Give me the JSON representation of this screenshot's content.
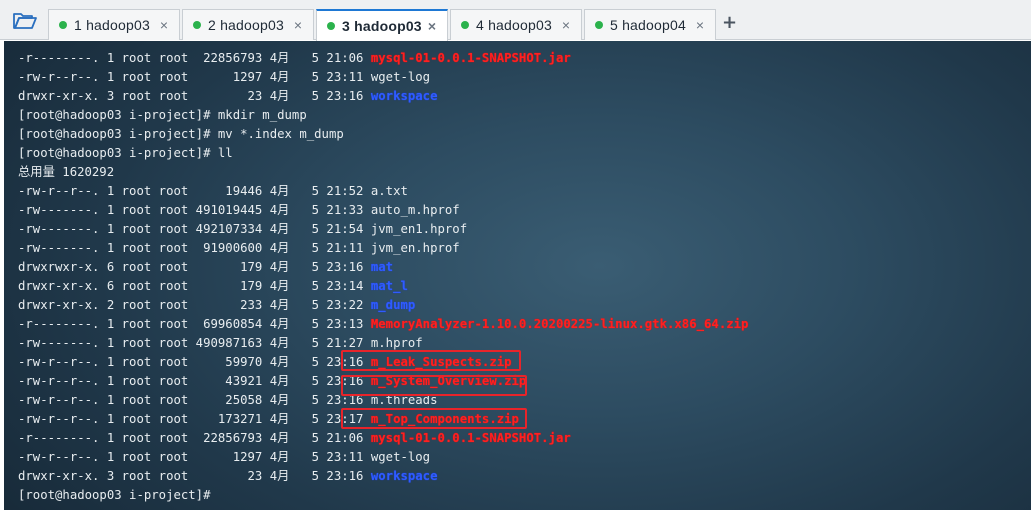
{
  "tabs": [
    {
      "label": "1 hadoop03",
      "active": false
    },
    {
      "label": "2 hadoop03",
      "active": false
    },
    {
      "label": "3 hadoop03",
      "active": true
    },
    {
      "label": "4 hadoop03",
      "active": false
    },
    {
      "label": "5 hadoop04",
      "active": false
    }
  ],
  "tab_close_glyph": "×",
  "new_tab_glyph": "+",
  "colors": {
    "tab_status_dot": "#2bb24c",
    "active_tab_accent": "#1e78d4",
    "filename_red": "#ff2020",
    "filename_blue": "#2f5cff",
    "highlight_box": "#e8242a"
  },
  "terminal": {
    "lines": [
      {
        "text": "-r--------. 1 root root  22856793 4月   5 21:06 ",
        "file": "mysql-01-0.0.1-SNAPSHOT.jar",
        "color": "red"
      },
      {
        "text": "-rw-r--r--. 1 root root      1297 4月   5 23:11 ",
        "file": "wget-log",
        "color": "plain"
      },
      {
        "text": "drwxr-xr-x. 3 root root        23 4月   5 23:16 ",
        "file": "workspace",
        "color": "blue"
      },
      {
        "text": "[root@hadoop03 i-project]# mkdir m_dump",
        "file": "",
        "color": "plain"
      },
      {
        "text": "[root@hadoop03 i-project]# mv *.index m_dump",
        "file": "",
        "color": "plain"
      },
      {
        "text": "[root@hadoop03 i-project]# ll",
        "file": "",
        "color": "plain"
      },
      {
        "text": "总用量 1620292",
        "file": "",
        "color": "plain"
      },
      {
        "text": "-rw-r--r--. 1 root root     19446 4月   5 21:52 ",
        "file": "a.txt",
        "color": "plain"
      },
      {
        "text": "-rw-------. 1 root root 491019445 4月   5 21:33 ",
        "file": "auto_m.hprof",
        "color": "plain"
      },
      {
        "text": "-rw-------. 1 root root 492107334 4月   5 21:54 ",
        "file": "jvm_en1.hprof",
        "color": "plain"
      },
      {
        "text": "-rw-------. 1 root root  91900600 4月   5 21:11 ",
        "file": "jvm_en.hprof",
        "color": "plain"
      },
      {
        "text": "drwxrwxr-x. 6 root root       179 4月   5 23:16 ",
        "file": "mat",
        "color": "blue"
      },
      {
        "text": "drwxr-xr-x. 6 root root       179 4月   5 23:14 ",
        "file": "mat_l",
        "color": "blue"
      },
      {
        "text": "drwxr-xr-x. 2 root root       233 4月   5 23:22 ",
        "file": "m_dump",
        "color": "blue"
      },
      {
        "text": "-r--------. 1 root root  69960854 4月   5 23:13 ",
        "file": "MemoryAnalyzer-1.10.0.20200225-linux.gtk.x86_64.zip",
        "color": "red"
      },
      {
        "text": "-rw-------. 1 root root 490987163 4月   5 21:27 ",
        "file": "m.hprof",
        "color": "plain"
      },
      {
        "text": "-rw-r--r--. 1 root root     59970 4月   5 23:16 ",
        "file": "m_Leak_Suspects.zip",
        "color": "red"
      },
      {
        "text": "-rw-r--r--. 1 root root     43921 4月   5 23:16 ",
        "file": "m_System_Overview.zip",
        "color": "red"
      },
      {
        "text": "-rw-r--r--. 1 root root     25058 4月   5 23:16 ",
        "file": "m.threads",
        "color": "plain"
      },
      {
        "text": "-rw-r--r--. 1 root root    173271 4月   5 23:17 ",
        "file": "m_Top_Components.zip",
        "color": "red"
      },
      {
        "text": "-r--------. 1 root root  22856793 4月   5 21:06 ",
        "file": "mysql-01-0.0.1-SNAPSHOT.jar",
        "color": "red"
      },
      {
        "text": "-rw-r--r--. 1 root root      1297 4月   5 23:11 ",
        "file": "wget-log",
        "color": "plain"
      },
      {
        "text": "drwxr-xr-x. 3 root root        23 4月   5 23:16 ",
        "file": "workspace",
        "color": "blue"
      },
      {
        "text": "[root@hadoop03 i-project]# ",
        "file": "",
        "color": "plain"
      }
    ]
  }
}
